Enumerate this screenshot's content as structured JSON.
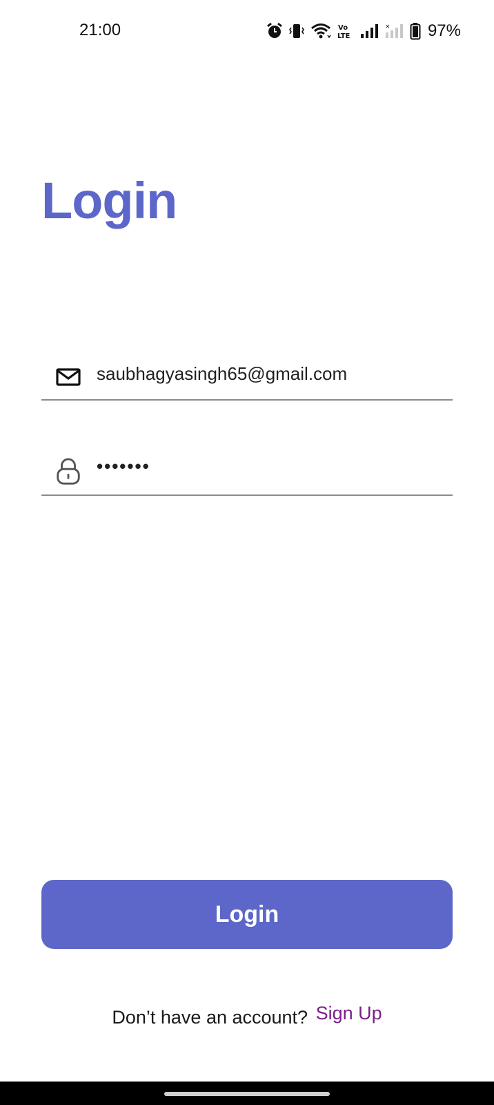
{
  "status_bar": {
    "time": "21:00",
    "battery_percent": "97%",
    "icons": [
      "alarm-icon",
      "vibrate-icon",
      "wifi-icon",
      "volte-icon",
      "signal-icon",
      "signal-no-sim-icon",
      "battery-icon"
    ]
  },
  "page": {
    "title": "Login"
  },
  "form": {
    "email": {
      "icon": "mail-icon",
      "value": "saubhagyasingh65@gmail.com"
    },
    "password": {
      "icon": "lock-icon",
      "value": "•••••••"
    }
  },
  "actions": {
    "login_label": "Login"
  },
  "footer": {
    "prompt": "Don’t have an account?",
    "signup_label": "Sign Up"
  },
  "colors": {
    "accent": "#5c67c9",
    "link": "#7a1f8a"
  }
}
